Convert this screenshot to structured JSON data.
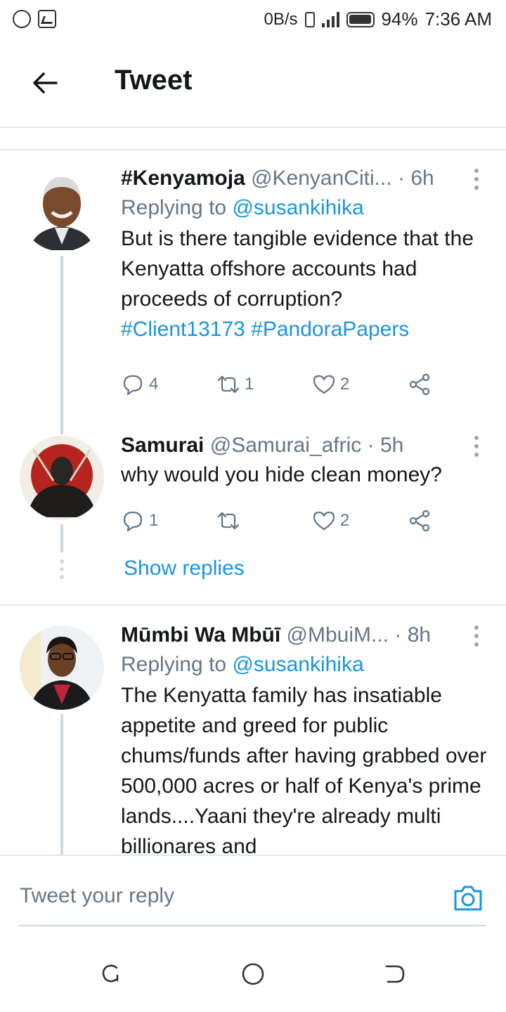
{
  "status_bar": {
    "left_icons": [
      "whatsapp-icon",
      "gallery-icon"
    ],
    "speed": "0B/s",
    "battery": "94%",
    "time": "7:36 AM"
  },
  "header": {
    "title": "Tweet"
  },
  "tweets": [
    {
      "display_name": "#Kenyamoja",
      "handle": "@KenyanCiti...",
      "time": "6h",
      "replying_prefix": "Replying to ",
      "replying_to": "@susankihika",
      "text": "But is there tangible evidence that the Kenyatta offshore accounts had proceeds of corruption?",
      "hashtags": "#Client13173 #PandoraPapers",
      "reply_count": "4",
      "retweet_count": "1",
      "like_count": "2"
    },
    {
      "display_name": "Samurai",
      "handle": "@Samurai_afric",
      "time": "5h",
      "text": "why would you hide clean money?",
      "reply_count": "1",
      "retweet_count": "",
      "like_count": "2"
    },
    {
      "display_name": "Mūmbi Wa Mbūī",
      "handle": "@MbuiM...",
      "time": "8h",
      "replying_prefix": "Replying to ",
      "replying_to": "@susankihika",
      "text": "The Kenyatta family has insatiable appetite and greed for public chums/funds after having grabbed over 500,000 acres or half of Kenya's prime lands....Yaani they're already multi billionares and"
    }
  ],
  "show_replies": "Show replies",
  "reply_bar": {
    "placeholder": "Tweet your reply"
  },
  "colors": {
    "link": "#1b95e0",
    "secondary_text": "#657786",
    "divider": "#e1e8ed"
  }
}
